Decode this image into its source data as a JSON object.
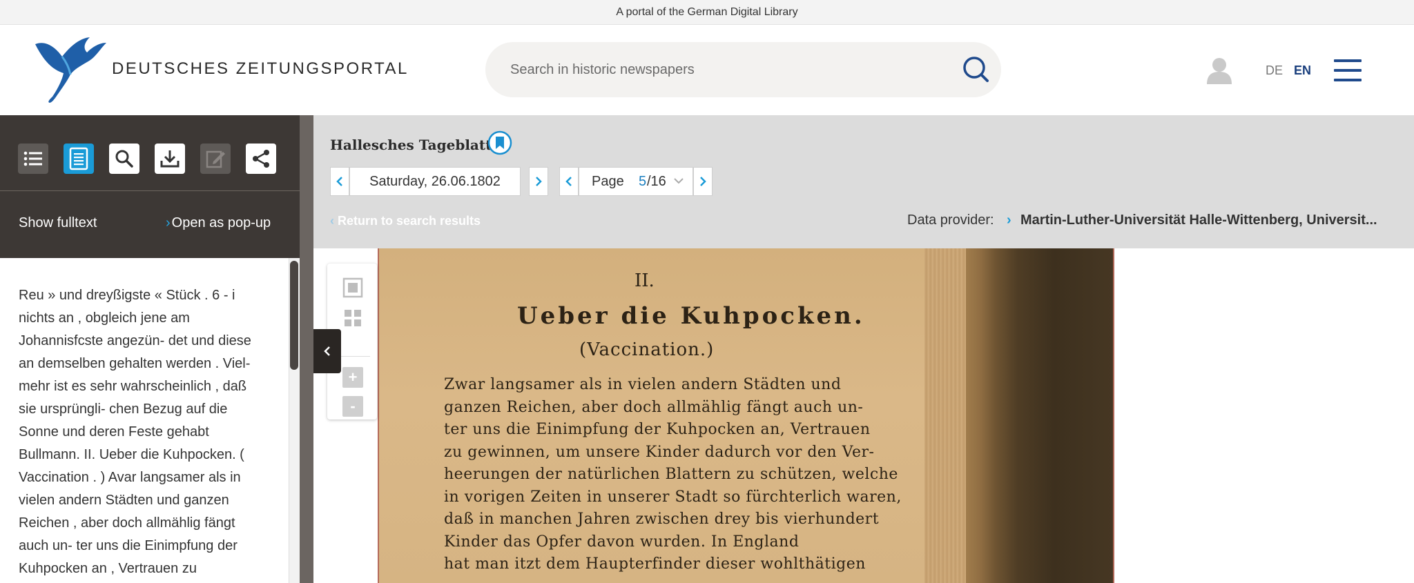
{
  "topbar": {
    "text": "A portal of the German Digital Library"
  },
  "header": {
    "logo_text": "DEUTSCHES ZEITUNGSPORTAL",
    "search_placeholder": "Search in historic newspapers",
    "lang_de": "DE",
    "lang_en": "EN"
  },
  "sidebar": {
    "tools": [
      "list-icon",
      "document-icon",
      "search-icon",
      "download-icon",
      "edit-icon",
      "share-icon"
    ],
    "show_fulltext": "Show fulltext",
    "open_popup": "Open as pop-up",
    "fulltext": "Reu » und dreyßigste « Stück . 6 - i nichts an , obgleich jene am Johannisfcste angezün- det und diese an demselben gehalten werden . Viel- mehr ist es sehr wahrscheinlich , daß sie ursprüngli- chen Bezug auf die Sonne und deren Feste gehabt Bullmann. II. Ueber die Kuhpocken. ( Vaccination . ) Avar langsamer als in vielen andern Städten und ganzen Reichen , aber doch allmählig fängt auch un- ter uns die Einimpfung der Kuhpocken an , Vertrauen zu"
  },
  "viewer": {
    "newspaper_title": "Hallesches Tageblatt",
    "date": "Saturday, 26.06.1802",
    "page_label": "Page",
    "page_current": "5",
    "page_total": "/16",
    "return_link": "Return to search results",
    "provider_label": "Data provider:",
    "provider_name": "Martin-Luther-Universität Halle-Wittenberg, Universit...",
    "scan": {
      "section_num": "II.",
      "heading": "Ueber die Kuhpocken.",
      "subheading": "(Vaccination.)",
      "lines": [
        "Zwar langsamer als in vielen andern Städten und",
        "ganzen Reichen, aber doch allmählig fängt auch un-",
        "ter uns die Einimpfung der Kuhpocken an, Vertrauen",
        "zu gewinnen, um unsere Kinder dadurch vor den Ver-",
        "heerungen der natürlichen Blattern zu schützen, welche",
        "in vorigen Zeiten in unserer Stadt so fürchterlich waren,",
        "daß in manchen Jahren zwischen drey bis vierhundert",
        "Kinder das Opfer davon wurden.  In England",
        "hat man itzt dem Haupterfinder dieser wohlthätigen"
      ]
    },
    "zoom_plus": "+",
    "zoom_minus": "-"
  },
  "colors": {
    "accent": "#1a9bd7",
    "brand": "#1f4a8c",
    "sidebar_bg": "#3d3835"
  }
}
